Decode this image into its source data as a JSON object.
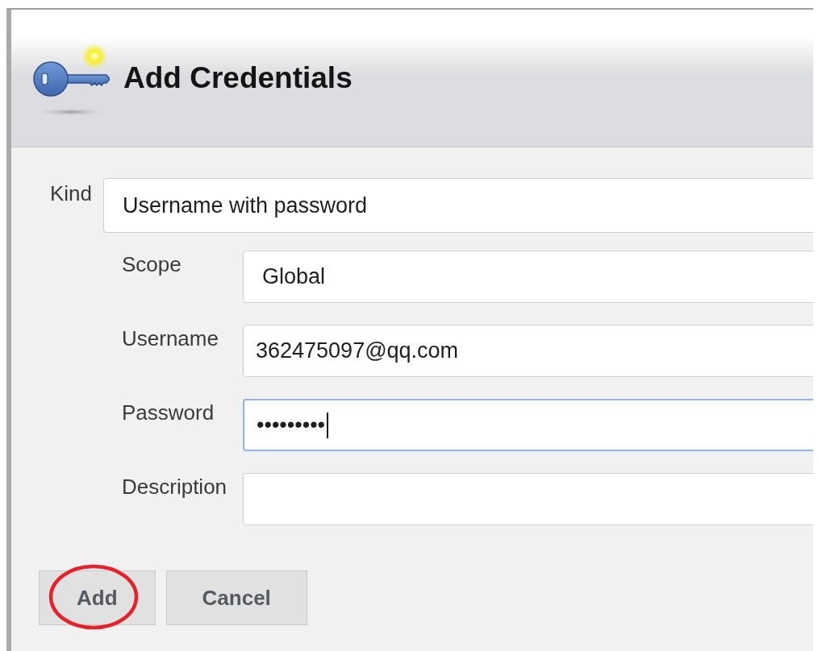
{
  "dialog": {
    "title": "Add Credentials"
  },
  "kind": {
    "label": "Kind",
    "value": "Username with password"
  },
  "fields": [
    {
      "kind": "select",
      "label": "Scope",
      "value": "Global",
      "focused": false
    },
    {
      "kind": "text",
      "label": "Username",
      "value": "362475097@qq.com",
      "focused": false
    },
    {
      "kind": "password",
      "label": "Password",
      "value": "•••••••••",
      "focused": true
    },
    {
      "kind": "text",
      "label": "Description",
      "focused": false
    }
  ],
  "buttons": [
    {
      "label": "Add",
      "annotated": true
    },
    {
      "label": "Cancel",
      "annotated": false
    }
  ]
}
